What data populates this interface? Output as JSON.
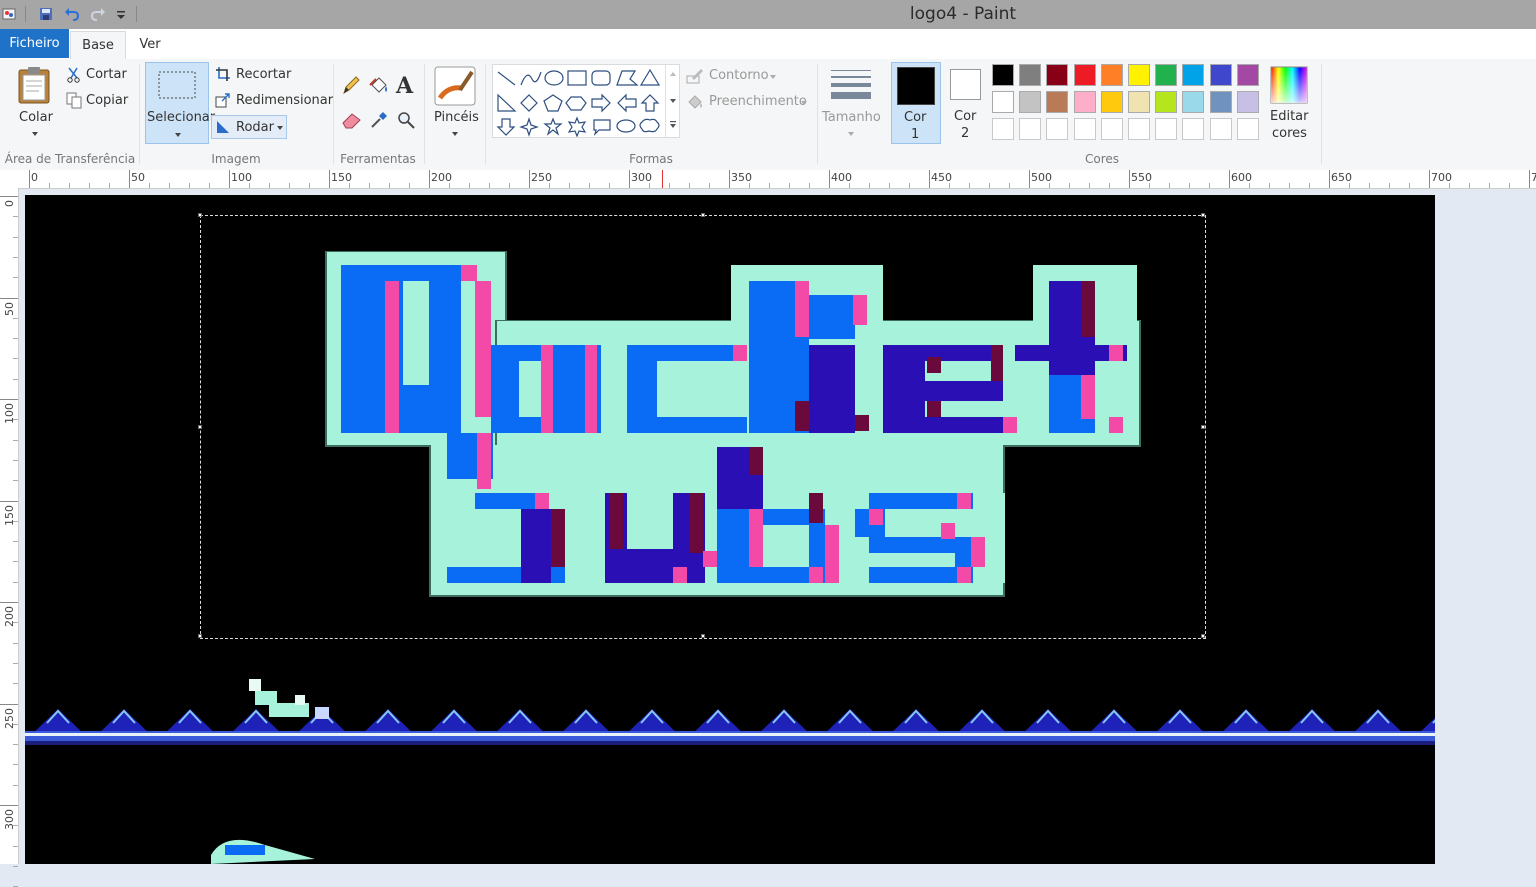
{
  "window": {
    "title": "logo4 - Paint"
  },
  "tabs": {
    "file": "Ficheiro",
    "home": "Base",
    "view": "Ver"
  },
  "clipboard": {
    "paste": "Colar",
    "cut": "Cortar",
    "copy": "Copiar",
    "group": "Área de Transferência"
  },
  "image": {
    "select": "Selecionar",
    "crop": "Recortar",
    "resize": "Redimensionar",
    "rotate": "Rodar",
    "group": "Imagem"
  },
  "tools": {
    "group": "Ferramentas"
  },
  "brushes": {
    "label": "Pincéis"
  },
  "shapes": {
    "outline": "Contorno",
    "fill": "Preenchimento",
    "group": "Formas"
  },
  "size": {
    "label": "Tamanho"
  },
  "colors": {
    "color1": "Cor",
    "color1_num": "1",
    "color2": "Cor",
    "color2_num": "2",
    "edit": "Editar",
    "edit2": "cores",
    "group": "Cores",
    "color1_value": "#000000",
    "color2_value": "#ffffff",
    "palette_row1": [
      "#000000",
      "#7f7f7f",
      "#880015",
      "#ed1c24",
      "#ff7f27",
      "#fff200",
      "#22b14c",
      "#00a2e8",
      "#3f48cc",
      "#a349a4"
    ],
    "palette_row2": [
      "#ffffff",
      "#c3c3c3",
      "#b97a57",
      "#ffaec9",
      "#ffc90e",
      "#efe4b0",
      "#b5e61d",
      "#99d9ea",
      "#7092be",
      "#c8bfe7"
    ]
  },
  "ruler": {
    "h": [
      "0",
      "50",
      "100",
      "150",
      "200",
      "250",
      "300",
      "350",
      "400",
      "450",
      "500",
      "550",
      "600",
      "650",
      "700",
      "75"
    ],
    "v": [
      "0",
      "50",
      "100",
      "150",
      "200",
      "250",
      "300"
    ]
  },
  "artwork": {
    "line1": "Rocket",
    "line2": "Tubs"
  }
}
